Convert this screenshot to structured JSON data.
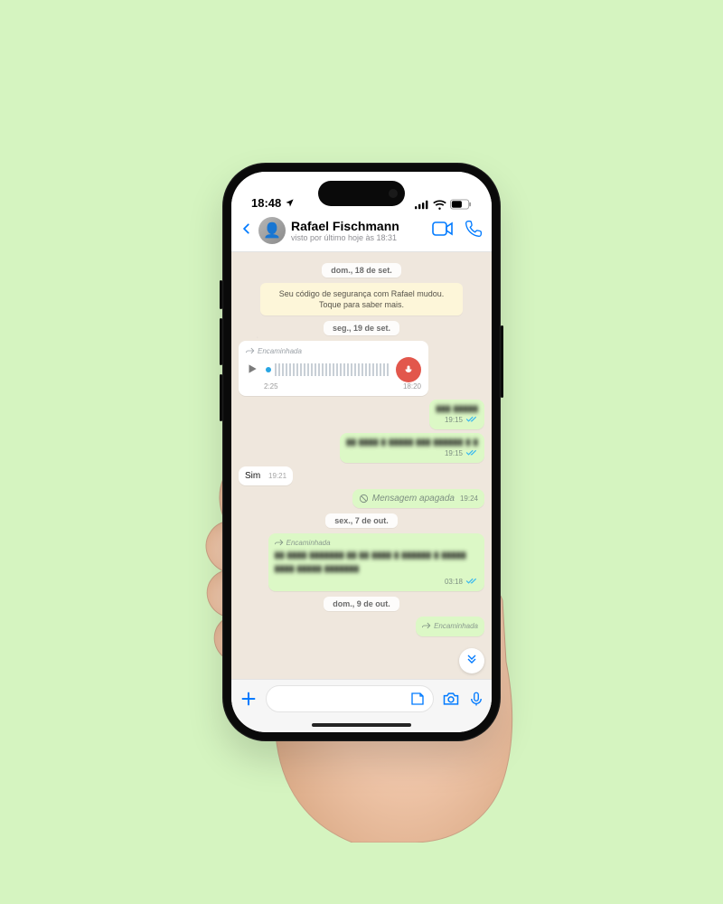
{
  "status": {
    "time": "18:48"
  },
  "header": {
    "name": "Rafael Fischmann",
    "subtitle": "visto por último hoje às 18:31"
  },
  "days": {
    "d1": "dom., 18 de set.",
    "d2": "seg., 19 de set.",
    "d3": "sex., 7 de out.",
    "d4": "dom., 9 de out."
  },
  "system": {
    "securityNotice": "Seu código de segurança com Rafael mudou. Toque para saber mais."
  },
  "voice": {
    "forwarded": "Encaminhada",
    "duration": "2:25",
    "time": "18:20"
  },
  "msgs": {
    "out1": {
      "text": "▮▮▮ ▮▮▮▮▮",
      "time": "19:15"
    },
    "out2": {
      "text": "▮▮ ▮▮▮▮ ▮ ▮▮▮▮▮ ▮▮▮ ▮▮▮▮▮▮ ▮ ▮",
      "time": "19:15"
    },
    "in1": {
      "text": "Sim",
      "time": "19:21"
    },
    "deleted": {
      "text": "Mensagem apagada",
      "time": "19:24"
    },
    "out3": {
      "forwarded": "Encaminhada",
      "text": "▮▮ ▮▮▮▮ ▮▮▮▮▮▮▮ ▮▮ ▮▮ ▮▮▮▮ ▮ ▮▮▮▮▮▮ ▮ ▮▮▮▮▮ ▮▮▮▮ ▮▮▮▮▮ ▮▮▮▮▮▮▮",
      "time": "03:18"
    },
    "out4": {
      "forwarded": "Encaminhada"
    }
  },
  "input": {
    "placeholder": ""
  }
}
